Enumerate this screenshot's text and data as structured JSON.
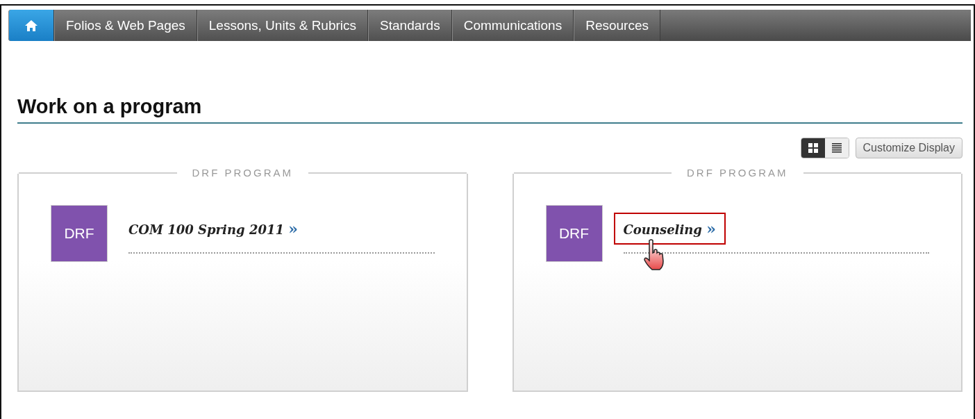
{
  "nav": {
    "tabs": [
      {
        "kind": "home",
        "selected": true
      },
      {
        "kind": "text",
        "label": "Folios & Web Pages",
        "selected": false
      },
      {
        "kind": "text",
        "label": "Lessons, Units & Rubrics",
        "selected": false
      },
      {
        "kind": "text",
        "label": "Standards",
        "selected": false
      },
      {
        "kind": "text",
        "label": "Communications",
        "selected": false
      },
      {
        "kind": "text",
        "label": "Resources",
        "selected": false
      }
    ]
  },
  "heading": "Work on a program",
  "view_toggle": [
    {
      "kind": "grid",
      "selected": true
    },
    {
      "kind": "list",
      "selected": false
    }
  ],
  "customize_button": "Customize Display",
  "programs": [
    {
      "legend": "DRF PROGRAM",
      "badge": "DRF",
      "color": "#8052ad",
      "title": "COM 100 Spring 2011",
      "chevron": "»",
      "highlighted": false,
      "pointer": false
    },
    {
      "legend": "DRF PROGRAM",
      "badge": "DRF",
      "color": "#8052ad",
      "title": "Counseling",
      "chevron": "»",
      "highlighted": true,
      "pointer": true
    }
  ]
}
